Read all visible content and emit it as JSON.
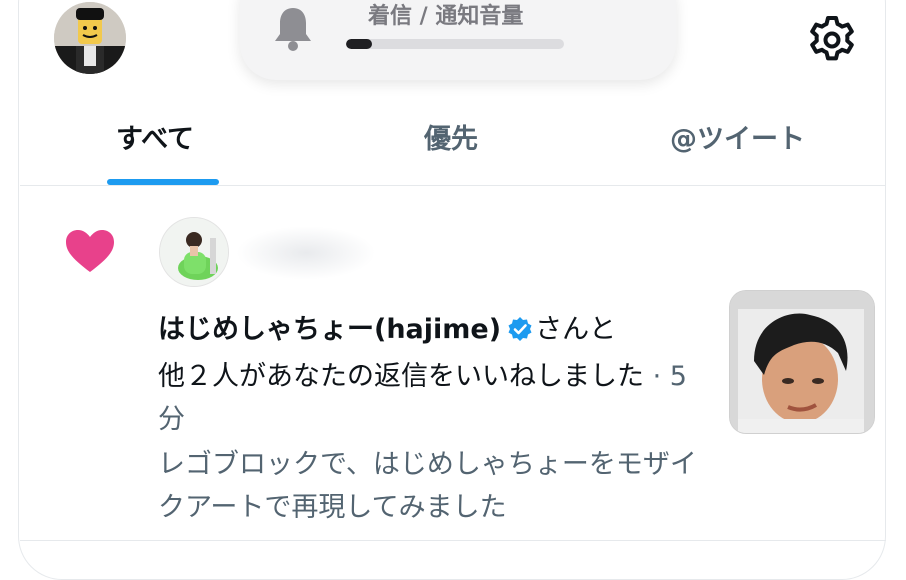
{
  "hud": {
    "title": "着信 / 通知音量",
    "volume_fraction": 0.12
  },
  "tabs": [
    {
      "label": "すべて"
    },
    {
      "label": "優先"
    },
    {
      "label": "@ツイート"
    }
  ],
  "notification": {
    "user_name": "はじめしゃちょー(hajime)",
    "action_part1": "さんと",
    "action_part2": "他２人があなたの返信をいいねしました",
    "separator": " · ",
    "time": "5分",
    "snippet": "レゴブロックで、はじめしゃちょーをモザイクアートで再現してみました"
  },
  "colors": {
    "accent": "#1d9bf0",
    "heart": "#f91880",
    "secondary_text": "#536471",
    "primary_text": "#0f1419"
  },
  "icons": [
    "bell-icon",
    "gear-icon",
    "heart-icon",
    "verified-badge-icon"
  ]
}
